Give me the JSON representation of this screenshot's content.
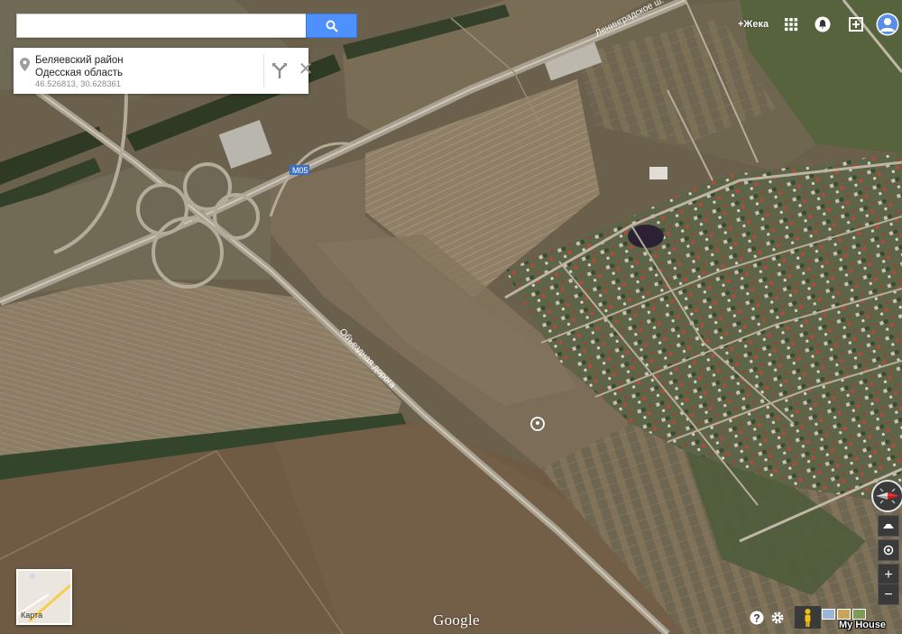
{
  "search": {
    "value": "",
    "placeholder": ""
  },
  "place_card": {
    "name": "Беляевский район",
    "region": "Одесская область",
    "coords": "46.526813, 30.628361"
  },
  "header": {
    "plus_user": "+Жека"
  },
  "map_labels": {
    "leningradskoe": "Ленинградское ш.",
    "m05": "M05",
    "obezdnaya": "Объездная дорога"
  },
  "minimap": {
    "label": "Карта"
  },
  "footer": {
    "logo": "Google",
    "watermark": "My House"
  },
  "controls": {
    "zoom_in": "+",
    "zoom_out": "−"
  },
  "icons": [
    "search-icon",
    "location-pin-icon",
    "directions-icon",
    "close-icon",
    "apps-grid-icon",
    "notifications-icon",
    "share-icon",
    "avatar-icon",
    "compass-icon",
    "tilt-icon",
    "my-location-icon",
    "zoom-in-icon",
    "zoom-out-icon",
    "help-icon",
    "settings-icon",
    "pegman-icon"
  ],
  "colors": {
    "search_button": "#4d90fe",
    "field": "#7a6a53",
    "grass": "#55603a",
    "road": "#a8a091"
  }
}
